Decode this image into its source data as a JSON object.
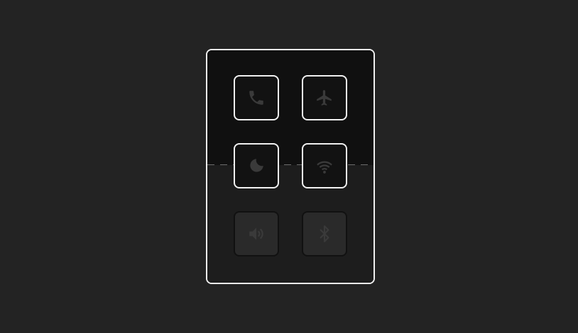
{
  "colors": {
    "background": "#232323",
    "panel_top": "#101010",
    "panel_bottom": "#1d1d1d",
    "highlight_outline": "#f0f0f0",
    "icon": "#3a3a3a"
  },
  "quick_settings": {
    "buttons": [
      {
        "icon": "phone-icon"
      },
      {
        "icon": "airplane-icon"
      },
      {
        "icon": "moon-icon"
      },
      {
        "icon": "wifi-icon"
      },
      {
        "icon": "speaker-icon"
      },
      {
        "icon": "bluetooth-icon"
      }
    ]
  }
}
